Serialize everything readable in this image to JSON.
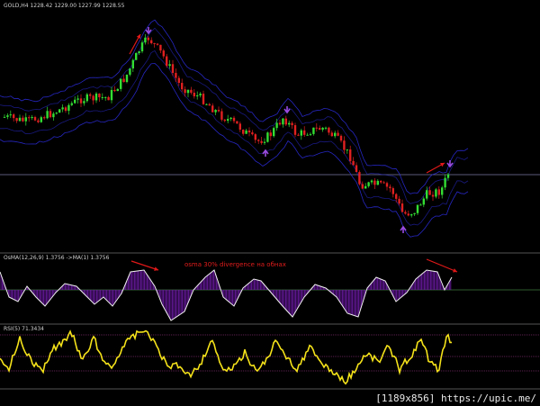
{
  "main_panel": {
    "header": "GOLD,H4  1228.42 1229.00 1227.99 1228.55",
    "colors": {
      "up": "#33dd33",
      "down": "#e02020",
      "band": "#2a2ad6",
      "hline": "#5a5a7a",
      "arrow": "#9a4ce0",
      "note_arrow": "#e01818"
    }
  },
  "osma_panel": {
    "header": "OsMA(12,26,9) 1.3756 ->MA(1) 1.3756",
    "annotation": "osma 30% divergence на обнах",
    "colors": {
      "line": "#f0f0f0",
      "hist": "#6a1aa0",
      "zero": "#2e5a2e"
    }
  },
  "rsi_panel": {
    "header": "RSI(5) 71.3434",
    "colors": {
      "line": "#f4e21a",
      "level": "#7a2a6a"
    }
  },
  "watermark": "[1189x856] https://upic.me/"
}
